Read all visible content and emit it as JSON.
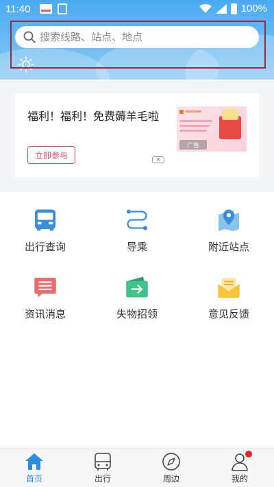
{
  "status_bar": {
    "time": "11:40",
    "battery": "100%"
  },
  "search": {
    "placeholder": "搜索线路、站点、地点"
  },
  "weather": {
    "icon": "sun-icon"
  },
  "ad": {
    "title": "福利！福利！免费薅羊毛啦",
    "button": "立即参与",
    "close_label": "×",
    "badge": "广告"
  },
  "menu": {
    "items": [
      {
        "label": "出行查询",
        "icon": "bus-icon",
        "color": "#3a8fd6"
      },
      {
        "label": "导乘",
        "icon": "route-icon",
        "color": "#3a8fd6"
      },
      {
        "label": "附近站点",
        "icon": "map-pin-icon",
        "color": "#4a9be0"
      },
      {
        "label": "资讯消息",
        "icon": "message-icon",
        "color": "#ee6a6a"
      },
      {
        "label": "失物招领",
        "icon": "lost-found-icon",
        "color": "#3fc48a"
      },
      {
        "label": "意见反馈",
        "icon": "feedback-icon",
        "color": "#f7c43a"
      }
    ]
  },
  "bottom_nav": {
    "items": [
      {
        "label": "首页",
        "icon": "home-icon",
        "active": true
      },
      {
        "label": "出行",
        "icon": "bus-icon",
        "active": false
      },
      {
        "label": "周边",
        "icon": "compass-icon",
        "active": false
      },
      {
        "label": "我的",
        "icon": "profile-icon",
        "active": false
      }
    ]
  },
  "colors": {
    "accent": "#2d8ee0",
    "header": "#4aaaf2",
    "ad_button": "#e0466a",
    "notification_dot": "#e8262b"
  }
}
